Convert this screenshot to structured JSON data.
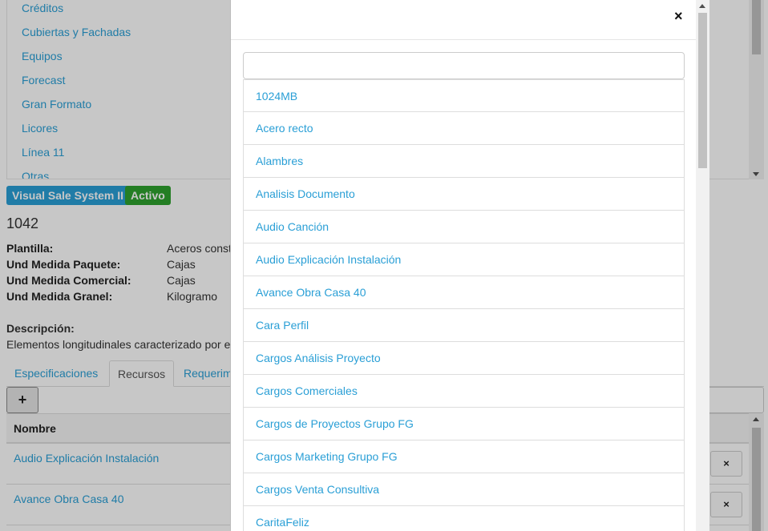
{
  "categories": [
    "Créditos",
    "Cubiertas y Fachadas",
    "Equipos",
    "Forecast",
    "Gran Formato",
    "Licores",
    "Línea 11",
    "Otras"
  ],
  "badges": {
    "system": "Visual Sale System II",
    "status": "Activo"
  },
  "product": {
    "code": "1042",
    "attributes": [
      {
        "label": "Plantilla:",
        "value": "Aceros const"
      },
      {
        "label": "Und Medida Paquete:",
        "value": "Cajas"
      },
      {
        "label": "Und Medida Comercial:",
        "value": "Cajas"
      },
      {
        "label": "Und Medida Granel:",
        "value": "Kilogramo"
      }
    ],
    "description_label": "Descripción:",
    "description": "Elementos longitudinales caracterizado por e"
  },
  "tabs": [
    "Especificaciones",
    "Recursos",
    "Requerim"
  ],
  "active_tab": "Recursos",
  "toolbar": {
    "add_label": "+"
  },
  "table": {
    "header": "Nombre",
    "rows": [
      "Audio Explicación Instalación",
      "Avance Obra Casa 40"
    ],
    "delete_label": "×"
  },
  "modal": {
    "close_label": "×",
    "search_value": "",
    "options": [
      "1024MB",
      "Acero recto",
      "Alambres",
      "Analisis Documento",
      "Audio Canción",
      "Audio Explicación Instalación",
      "Avance Obra Casa 40",
      "Cara Perfil",
      "Cargos Análisis Proyecto",
      "Cargos Comerciales",
      "Cargos de Proyectos Grupo FG",
      "Cargos Marketing Grupo FG",
      "Cargos Venta Consultiva",
      "CaritaFeliz"
    ]
  },
  "colors": {
    "link": "#2a9fd6",
    "info": "#2a9fd6",
    "success": "#2fa22f"
  }
}
